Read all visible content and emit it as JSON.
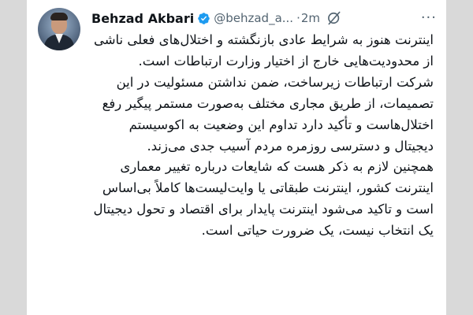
{
  "tweet": {
    "author_name": "Behzad Akbari",
    "handle": "@behzad_a...",
    "separator": "·",
    "time": "2m",
    "more_label": "···",
    "paragraphs": [
      "اینترنت هنوز به شرایط عادی بازنگشته و اختلال‌های فعلی ناشی از محدودیت‌هایی خارج از اختیار وزارت ارتباطات است.",
      "شرکت ارتباطات زیرساخت، ضمن نداشتن مسئولیت در این تصمیمات، از طریق مجاری مختلف به‌صورت مستمر پیگیر رفع اختلال‌هاست و تأکید دارد تداوم این وضعیت به اکوسیستم دیجیتال و دسترسی روزمره مردم آسیب جدی می‌زند.",
      "همچنین لازم به ذکر هست که شایعات درباره تغییر معماری اینترنت کشور، اینترنت طبقاتی یا وایت‌لیست‌ها کاملاً بی‌اساس است و تاکید می‌شود اینترنت پایدار برای اقتصاد و تحول دیجیتال یک انتخاب نیست، یک ضرورت حیاتی است."
    ]
  },
  "icons": {
    "verified": "verified-badge-icon",
    "grok": "grok-icon",
    "more": "more-options-icon"
  },
  "colors": {
    "verified": "#1d9bf0",
    "text": "#0f1419",
    "secondary": "#536471",
    "background": "#d9d9d9"
  }
}
